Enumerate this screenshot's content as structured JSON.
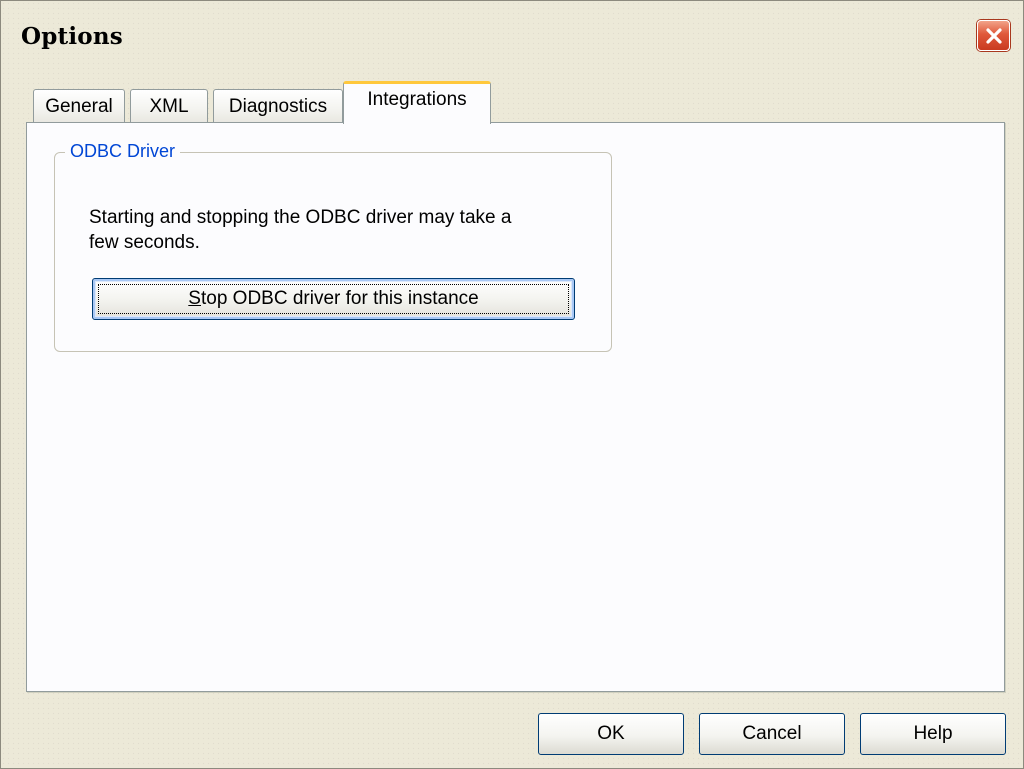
{
  "window": {
    "title": "Options",
    "close_icon": "close-icon"
  },
  "tabs": [
    {
      "label": "General",
      "active": false
    },
    {
      "label": "XML",
      "active": false
    },
    {
      "label": "Diagnostics",
      "active": false
    },
    {
      "label": "Integrations",
      "active": true
    }
  ],
  "odbc_group": {
    "legend": "ODBC Driver",
    "description_line1": "Starting and stopping the ODBC driver may take a",
    "description_line2": "few seconds.",
    "button_mnemonic": "S",
    "button_rest": "top ODBC driver for this instance"
  },
  "footer": {
    "ok_label": "OK",
    "cancel_label": "Cancel",
    "help_label": "Help"
  },
  "colors": {
    "accent": "#0046d5",
    "tab_highlight": "#ffc83c",
    "close_button": "#e0593b"
  }
}
